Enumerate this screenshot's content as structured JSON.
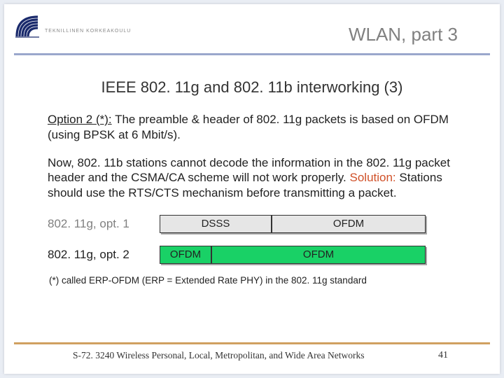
{
  "header": {
    "logo_text": "TEKNILLINEN KORKEAKOULU",
    "title": "WLAN, part 3"
  },
  "slide": {
    "title": "IEEE 802. 11g and 802. 11b interworking (3)",
    "para1": {
      "option_label": "Option 2 (*):",
      "rest": " The preamble & header of 802. 11g packets is based on OFDM (using BPSK at 6 Mbit/s)."
    },
    "para2": {
      "lead": "Now, 802. 11b stations cannot decode the information in the 802. 11g packet header and the CSMA/CA scheme will not work properly. ",
      "solution_label": "Solution:",
      "rest": " Stations should use the RTS/CTS mechanism before transmitting a packet."
    },
    "diagram": {
      "row1": {
        "label": "802. 11g, opt. 1",
        "bar1": "DSSS",
        "bar2": "OFDM"
      },
      "row2": {
        "label": "802. 11g, opt. 2",
        "bar1": "OFDM",
        "bar2": "OFDM"
      }
    },
    "footnote": "(*) called ERP-OFDM (ERP = Extended Rate PHY) in the 802. 11g standard"
  },
  "footer": {
    "course": "S-72. 3240 Wireless Personal, Local, Metropolitan, and Wide Area Networks",
    "page": "41"
  }
}
